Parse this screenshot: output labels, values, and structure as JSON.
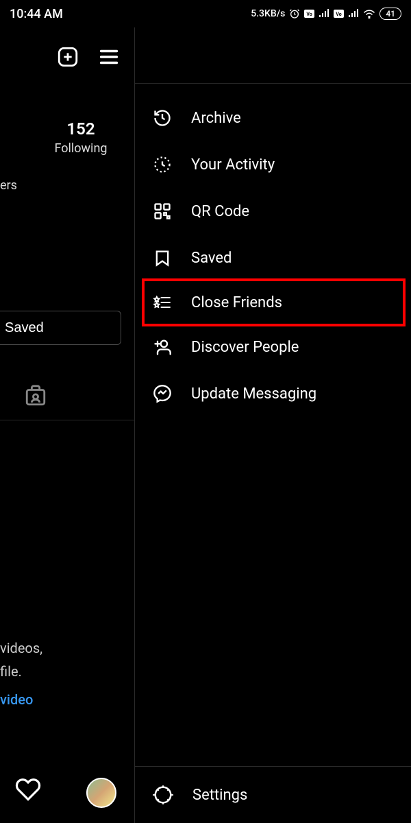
{
  "status": {
    "time": "10:44 AM",
    "data_rate": "5.3KB/s",
    "battery": "41"
  },
  "profile": {
    "following_count": "152",
    "following_label": "Following",
    "followers_partial": "ers",
    "saved_button": "Saved",
    "promo_line1": "videos,",
    "promo_line2": "file.",
    "promo_link": "video"
  },
  "menu": {
    "archive": "Archive",
    "your_activity": "Your Activity",
    "qr_code": "QR Code",
    "saved": "Saved",
    "close_friends": "Close Friends",
    "discover_people": "Discover People",
    "update_messaging": "Update Messaging",
    "settings": "Settings"
  }
}
